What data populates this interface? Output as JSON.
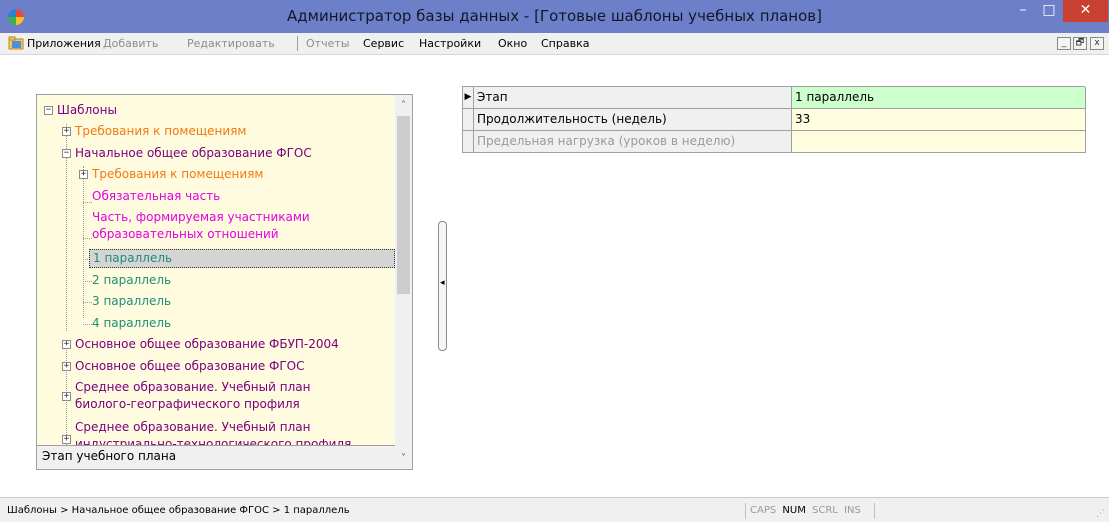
{
  "window": {
    "title": "Администратор базы данных - [Готовые шаблоны учебных планов]",
    "min_glyph": "–",
    "max_glyph": "□",
    "close_glyph": "✕"
  },
  "menu": {
    "items": [
      {
        "label": "Приложения"
      },
      {
        "label": "Добавить"
      },
      {
        "label": "Редактировать"
      },
      {
        "label": "Отчеты"
      },
      {
        "label": "Сервис"
      },
      {
        "label": "Настройки"
      },
      {
        "label": "Окно"
      },
      {
        "label": "Справка"
      }
    ],
    "mdi": {
      "min": "_",
      "restore": "🗗",
      "close": "x"
    }
  },
  "tree": {
    "nodes": [
      {
        "label": "Шаблоны",
        "color": "#7a0080",
        "expander": "⊟"
      },
      {
        "label": "Требования к помещениям",
        "color": "#f07a13",
        "expander": "⊞"
      },
      {
        "label": "Начальное общее образование ФГОС",
        "color": "#7a0080",
        "expander": "⊟"
      },
      {
        "label": "Требования к помещениям",
        "color": "#f07a13",
        "expander": "⊞"
      },
      {
        "label": "Обязательная часть",
        "color": "#e400e4"
      },
      {
        "label": "Часть, формируемая участниками",
        "label2": "образовательных отношений",
        "color": "#e400e4"
      },
      {
        "label": "1 параллель",
        "color": "#1e8c7a",
        "selected": true
      },
      {
        "label": "2 параллель",
        "color": "#1e8c7a"
      },
      {
        "label": "3 параллель",
        "color": "#1e8c7a"
      },
      {
        "label": "4 параллель",
        "color": "#1e8c7a"
      },
      {
        "label": "Основное общее образование ФБУП-2004",
        "color": "#7a0080",
        "expander": "⊞"
      },
      {
        "label": "Основное общее образование ФГОС",
        "color": "#7a0080",
        "expander": "⊞"
      },
      {
        "label": "Среднее образование. Учебный план",
        "label2": "биолого-географического профиля",
        "color": "#7a0080",
        "expander": "⊞"
      },
      {
        "label": "Среднее образование. Учебный план",
        "label2": "индустриально-технологического профиля",
        "color": "#7a0080",
        "expander": "⊞"
      }
    ],
    "footer": "Этап учебного плана",
    "scroll_up": "˄",
    "scroll_down": "˅"
  },
  "splitter_glyph": "◂",
  "grid": {
    "rows": [
      {
        "name": "Этап",
        "value": "1 параллель",
        "indicator": "▶"
      },
      {
        "name": "Продолжительность (недель)",
        "value": "33",
        "indicator": ""
      },
      {
        "name": "Предельная нагрузка (уроков в неделю)",
        "value": "",
        "indicator": ""
      }
    ]
  },
  "status": {
    "path": "Шаблоны > Начальное общее образование ФГОС > 1 параллель",
    "keys": [
      {
        "label": "CAPS",
        "on": false
      },
      {
        "label": "NUM",
        "on": true
      },
      {
        "label": "SCRL",
        "on": false
      },
      {
        "label": "INS",
        "on": false
      }
    ]
  },
  "colors": {
    "titlebar": "#6d7fc9",
    "tree_background": "#fffbdf",
    "active_value": "#ccffcc",
    "close_button": "#c84031"
  }
}
